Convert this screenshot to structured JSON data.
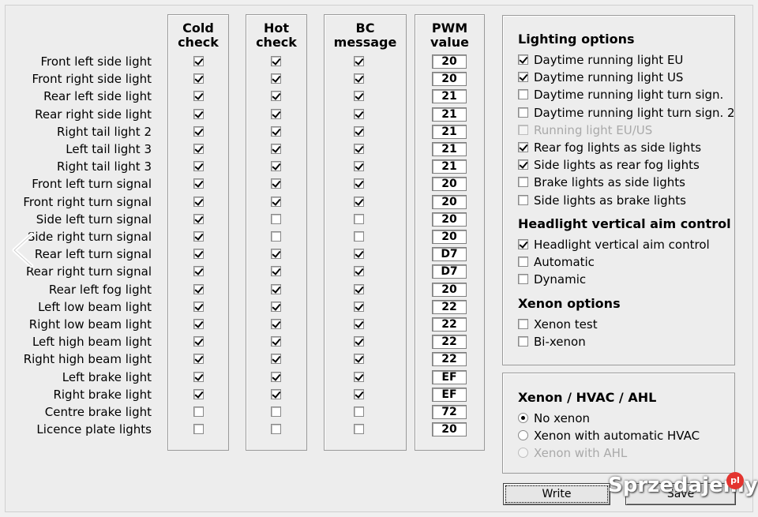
{
  "columns": {
    "cold": "Cold\ncheck",
    "hot": "Hot\ncheck",
    "bc": "BC\nmessage",
    "pwm": "PWM\nvalue"
  },
  "rows": [
    {
      "label": "Front left side light",
      "cold": true,
      "hot": true,
      "bc": true,
      "pwm": "20"
    },
    {
      "label": "Front right side light",
      "cold": true,
      "hot": true,
      "bc": true,
      "pwm": "20"
    },
    {
      "label": "Rear left side light",
      "cold": true,
      "hot": true,
      "bc": true,
      "pwm": "21"
    },
    {
      "label": "Rear right side light",
      "cold": true,
      "hot": true,
      "bc": true,
      "pwm": "21"
    },
    {
      "label": "Right tail light 2",
      "cold": true,
      "hot": true,
      "bc": true,
      "pwm": "21"
    },
    {
      "label": "Left tail light 3",
      "cold": true,
      "hot": true,
      "bc": true,
      "pwm": "21"
    },
    {
      "label": "Right tail light 3",
      "cold": true,
      "hot": true,
      "bc": true,
      "pwm": "21"
    },
    {
      "label": "Front left turn signal",
      "cold": true,
      "hot": true,
      "bc": true,
      "pwm": "20"
    },
    {
      "label": "Front right turn signal",
      "cold": true,
      "hot": true,
      "bc": true,
      "pwm": "20"
    },
    {
      "label": "Side left turn signal",
      "cold": true,
      "hot": false,
      "bc": false,
      "pwm": "20"
    },
    {
      "label": "Side right turn signal",
      "cold": true,
      "hot": false,
      "bc": false,
      "pwm": "20"
    },
    {
      "label": "Rear left turn signal",
      "cold": true,
      "hot": true,
      "bc": true,
      "pwm": "D7"
    },
    {
      "label": "Rear right turn signal",
      "cold": true,
      "hot": true,
      "bc": true,
      "pwm": "D7"
    },
    {
      "label": "Rear left fog light",
      "cold": true,
      "hot": true,
      "bc": true,
      "pwm": "20"
    },
    {
      "label": "Left low beam light",
      "cold": true,
      "hot": true,
      "bc": true,
      "pwm": "22"
    },
    {
      "label": "Right low beam light",
      "cold": true,
      "hot": true,
      "bc": true,
      "pwm": "22"
    },
    {
      "label": "Left high beam light",
      "cold": true,
      "hot": true,
      "bc": true,
      "pwm": "22"
    },
    {
      "label": "Right high beam light",
      "cold": true,
      "hot": true,
      "bc": true,
      "pwm": "22"
    },
    {
      "label": "Left brake light",
      "cold": true,
      "hot": true,
      "bc": true,
      "pwm": "EF"
    },
    {
      "label": "Right brake light",
      "cold": true,
      "hot": true,
      "bc": true,
      "pwm": "EF"
    },
    {
      "label": "Centre brake light",
      "cold": false,
      "hot": false,
      "bc": false,
      "pwm": "72"
    },
    {
      "label": "Licence plate lights",
      "cold": false,
      "hot": false,
      "bc": false,
      "pwm": "20"
    }
  ],
  "lighting": {
    "title": "Lighting options",
    "options": [
      {
        "label": "Daytime running light EU",
        "checked": true,
        "disabled": false
      },
      {
        "label": "Daytime running light US",
        "checked": true,
        "disabled": false
      },
      {
        "label": "Daytime running light turn sign.",
        "checked": false,
        "disabled": false
      },
      {
        "label": "Daytime running light turn sign. 2",
        "checked": false,
        "disabled": false
      },
      {
        "label": "Running light EU/US",
        "checked": false,
        "disabled": true
      },
      {
        "label": "Rear fog lights as side lights",
        "checked": true,
        "disabled": false
      },
      {
        "label": "Side lights as rear fog lights",
        "checked": true,
        "disabled": false
      },
      {
        "label": "Brake lights as side lights",
        "checked": false,
        "disabled": false
      },
      {
        "label": "Side lights as brake lights",
        "checked": false,
        "disabled": false
      }
    ]
  },
  "aim": {
    "title": "Headlight vertical aim control",
    "options": [
      {
        "label": "Headlight vertical aim control",
        "checked": true,
        "disabled": false
      },
      {
        "label": "Automatic",
        "checked": false,
        "disabled": false
      },
      {
        "label": "Dynamic",
        "checked": false,
        "disabled": false
      }
    ]
  },
  "xenon": {
    "title": "Xenon options",
    "options": [
      {
        "label": "Xenon test",
        "checked": false,
        "disabled": false
      },
      {
        "label": "Bi-xenon",
        "checked": false,
        "disabled": false
      }
    ]
  },
  "hvac": {
    "title": "Xenon / HVAC / AHL",
    "options": [
      {
        "label": "No xenon",
        "selected": true,
        "disabled": false
      },
      {
        "label": "Xenon with automatic HVAC",
        "selected": false,
        "disabled": false
      },
      {
        "label": "Xenon with AHL",
        "selected": false,
        "disabled": true
      }
    ]
  },
  "buttons": {
    "write": "Write",
    "save": "Save"
  },
  "watermark": {
    "text": "Sprzedajemy",
    "badge": "pl"
  }
}
